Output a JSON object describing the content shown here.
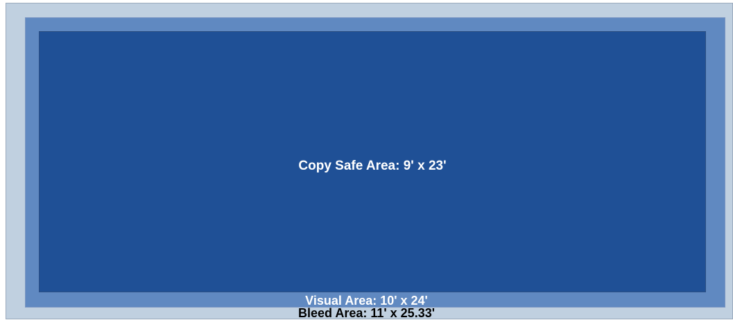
{
  "areas": {
    "bleed": {
      "label": "Bleed Area: 11' x 25.33'",
      "fill": "#c0d0e0"
    },
    "visual": {
      "label": "Visual Area: 10' x 24'",
      "fill": "#6089c1"
    },
    "copy_safe": {
      "label": "Copy Safe Area: 9' x 23'",
      "fill": "#1f5096"
    }
  },
  "colors": {
    "label_light": "#ffffff",
    "label_dark": "#000000"
  }
}
